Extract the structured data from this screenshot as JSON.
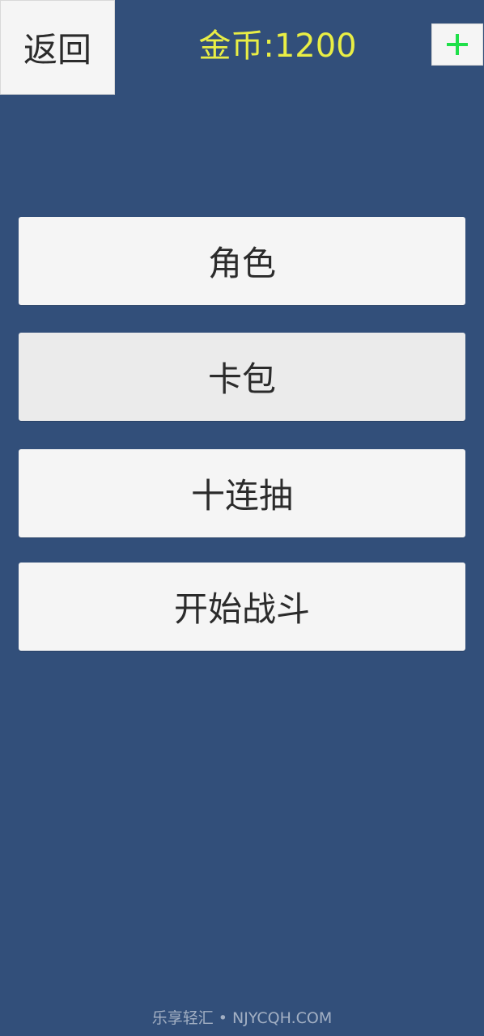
{
  "header": {
    "back_label": "返回",
    "coins_label": "金币:1200",
    "add_icon": "plus-icon"
  },
  "menu": {
    "items": [
      {
        "label": "角色"
      },
      {
        "label": "卡包"
      },
      {
        "label": "十连抽"
      },
      {
        "label": "开始战斗"
      }
    ]
  },
  "footer": {
    "watermark": "乐享轻汇 • NJYCQH.COM"
  },
  "colors": {
    "background": "#324f7a",
    "coin_text": "#e9ee45",
    "plus_icon": "#1fe04a",
    "button_bg": "#f5f5f5"
  }
}
